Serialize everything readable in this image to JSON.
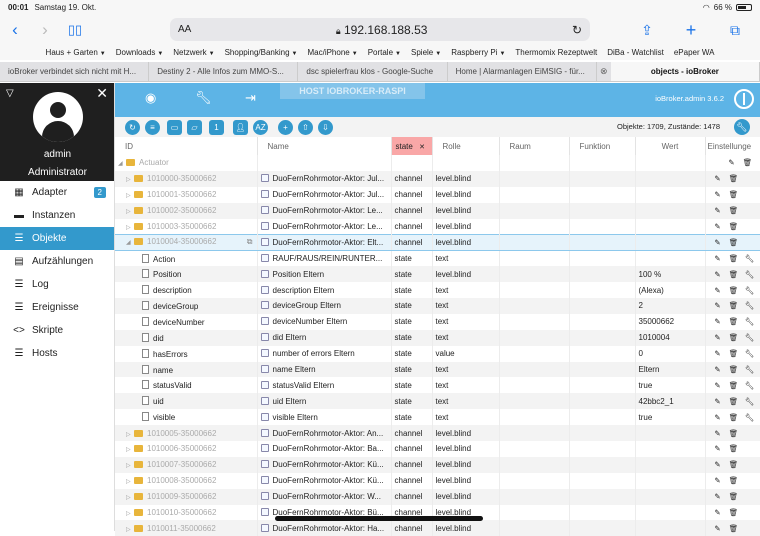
{
  "status": {
    "time": "00:01",
    "date": "Samstag 19. Okt.",
    "battery": "66 %"
  },
  "browser": {
    "aa": "AA",
    "url": "192.168.188.53",
    "favorites": [
      "Haus + Garten",
      "Downloads",
      "Netzwerk",
      "Shopping/Banking",
      "Mac/iPhone",
      "Portale",
      "Spiele",
      "Raspberry Pi",
      "Thermomix Rezeptwelt",
      "DiBa - Watchlist",
      "ePaper WA"
    ],
    "favorites_with_menu": [
      true,
      true,
      true,
      true,
      true,
      true,
      true,
      true,
      false,
      false,
      false
    ],
    "tabs": [
      "ioBroker verbindet sich nicht mit H...",
      "Destiny 2 - Alle Infos zum MMO-S...",
      "dsc spielerfrau klos - Google-Suche",
      "Home | Alarmanlagen EiMSIG - für...",
      "objects - ioBroker"
    ]
  },
  "sidebar": {
    "user": "admin",
    "role": "Administrator",
    "items": [
      {
        "label": "Adapter",
        "icon": "adapter-icon",
        "badge": "2"
      },
      {
        "label": "Instanzen",
        "icon": "instances-icon"
      },
      {
        "label": "Objekte",
        "icon": "objects-icon",
        "active": true
      },
      {
        "label": "Aufzählungen",
        "icon": "enums-icon"
      },
      {
        "label": "Log",
        "icon": "log-icon"
      },
      {
        "label": "Ereignisse",
        "icon": "events-icon"
      },
      {
        "label": "Skripte",
        "icon": "scripts-icon"
      },
      {
        "label": "Hosts",
        "icon": "hosts-icon"
      }
    ]
  },
  "topbar": {
    "host": "HOST IOBROKER-RASPI",
    "version": "ioBroker.admin 3.6.2"
  },
  "counts": "Objekte: 1709, Zustände: 1478",
  "columns": {
    "id": "ID",
    "name": "Name",
    "type_filter": "state",
    "role": "Rolle",
    "room": "Raum",
    "function": "Funktion",
    "value": "Wert",
    "settings": "Einstellunge"
  },
  "rows": [
    {
      "id": "Actuator",
      "kind": "folder",
      "level": 0,
      "open": true,
      "name": "",
      "type": "",
      "role": "",
      "value": "",
      "btns": "del"
    },
    {
      "id": "1010000-35000662",
      "kind": "folder",
      "level": 1,
      "name": "DuoFernRohrmotor-Aktor: Jul...",
      "type": "channel",
      "role": "level.blind",
      "value": "",
      "btns": "ed"
    },
    {
      "id": "1010001-35000662",
      "kind": "folder",
      "level": 1,
      "name": "DuoFernRohrmotor-Aktor: Jul...",
      "type": "channel",
      "role": "level.blind",
      "value": "",
      "btns": "ed"
    },
    {
      "id": "1010002-35000662",
      "kind": "folder",
      "level": 1,
      "name": "DuoFernRohrmotor-Aktor: Le...",
      "type": "channel",
      "role": "level.blind",
      "value": "",
      "btns": "ed"
    },
    {
      "id": "1010003-35000662",
      "kind": "folder",
      "level": 1,
      "name": "DuoFernRohrmotor-Aktor: Le...",
      "type": "channel",
      "role": "level.blind",
      "value": "",
      "btns": "ed"
    },
    {
      "id": "1010004-35000662",
      "kind": "folder",
      "level": 1,
      "open": true,
      "selected": true,
      "name": "DuoFernRohrmotor-Aktor: Elt...",
      "type": "channel",
      "role": "level.blind",
      "value": "",
      "btns": "ed"
    },
    {
      "id": "Action",
      "kind": "file",
      "level": 2,
      "name": "RAUF/RAUS/REIN/RUNTER...",
      "type": "state",
      "role": "text",
      "value": "",
      "btns": "edw"
    },
    {
      "id": "Position",
      "kind": "file",
      "level": 2,
      "name": "Position Eltern",
      "type": "state",
      "role": "level.blind",
      "value": "100 %",
      "btns": "edw"
    },
    {
      "id": "description",
      "kind": "file",
      "level": 2,
      "name": "description Eltern",
      "type": "state",
      "role": "text",
      "value": "(Alexa)",
      "btns": "edw"
    },
    {
      "id": "deviceGroup",
      "kind": "file",
      "level": 2,
      "name": "deviceGroup Eltern",
      "type": "state",
      "role": "text",
      "value": "2",
      "btns": "edw"
    },
    {
      "id": "deviceNumber",
      "kind": "file",
      "level": 2,
      "name": "deviceNumber Eltern",
      "type": "state",
      "role": "text",
      "value": "35000662",
      "btns": "edw"
    },
    {
      "id": "did",
      "kind": "file",
      "level": 2,
      "name": "did Eltern",
      "type": "state",
      "role": "text",
      "value": "1010004",
      "btns": "edw"
    },
    {
      "id": "hasErrors",
      "kind": "file",
      "level": 2,
      "name": "number of errors Eltern",
      "type": "state",
      "role": "value",
      "value": "0",
      "btns": "edw"
    },
    {
      "id": "name",
      "kind": "file",
      "level": 2,
      "name": "name Eltern",
      "type": "state",
      "role": "text",
      "value": "Eltern",
      "btns": "edw"
    },
    {
      "id": "statusValid",
      "kind": "file",
      "level": 2,
      "name": "statusValid Eltern",
      "type": "state",
      "role": "text",
      "value": "true",
      "btns": "edw"
    },
    {
      "id": "uid",
      "kind": "file",
      "level": 2,
      "name": "uid Eltern",
      "type": "state",
      "role": "text",
      "value": "42bbc2_1",
      "btns": "edw"
    },
    {
      "id": "visible",
      "kind": "file",
      "level": 2,
      "name": "visible Eltern",
      "type": "state",
      "role": "text",
      "value": "true",
      "btns": "edw"
    },
    {
      "id": "1010005-35000662",
      "kind": "folder",
      "level": 1,
      "name": "DuoFernRohrmotor-Aktor: An...",
      "type": "channel",
      "role": "level.blind",
      "value": "",
      "btns": "ed"
    },
    {
      "id": "1010006-35000662",
      "kind": "folder",
      "level": 1,
      "name": "DuoFernRohrmotor-Aktor: Ba...",
      "type": "channel",
      "role": "level.blind",
      "value": "",
      "btns": "ed"
    },
    {
      "id": "1010007-35000662",
      "kind": "folder",
      "level": 1,
      "name": "DuoFernRohrmotor-Aktor: Kü...",
      "type": "channel",
      "role": "level.blind",
      "value": "",
      "btns": "ed"
    },
    {
      "id": "1010008-35000662",
      "kind": "folder",
      "level": 1,
      "name": "DuoFernRohrmotor-Aktor: Kü...",
      "type": "channel",
      "role": "level.blind",
      "value": "",
      "btns": "ed"
    },
    {
      "id": "1010009-35000662",
      "kind": "folder",
      "level": 1,
      "name": "DuoFernRohrmotor-Aktor: W...",
      "type": "channel",
      "role": "level.blind",
      "value": "",
      "btns": "ed"
    },
    {
      "id": "1010010-35000662",
      "kind": "folder",
      "level": 1,
      "name": "DuoFernRohrmotor-Aktor: Bü...",
      "type": "channel",
      "role": "level.blind",
      "value": "",
      "btns": "ed"
    },
    {
      "id": "1010011-35000662",
      "kind": "folder",
      "level": 1,
      "name": "DuoFernRohrmotor-Aktor: Ha...",
      "type": "channel",
      "role": "level.blind",
      "value": "",
      "btns": "ed"
    }
  ]
}
